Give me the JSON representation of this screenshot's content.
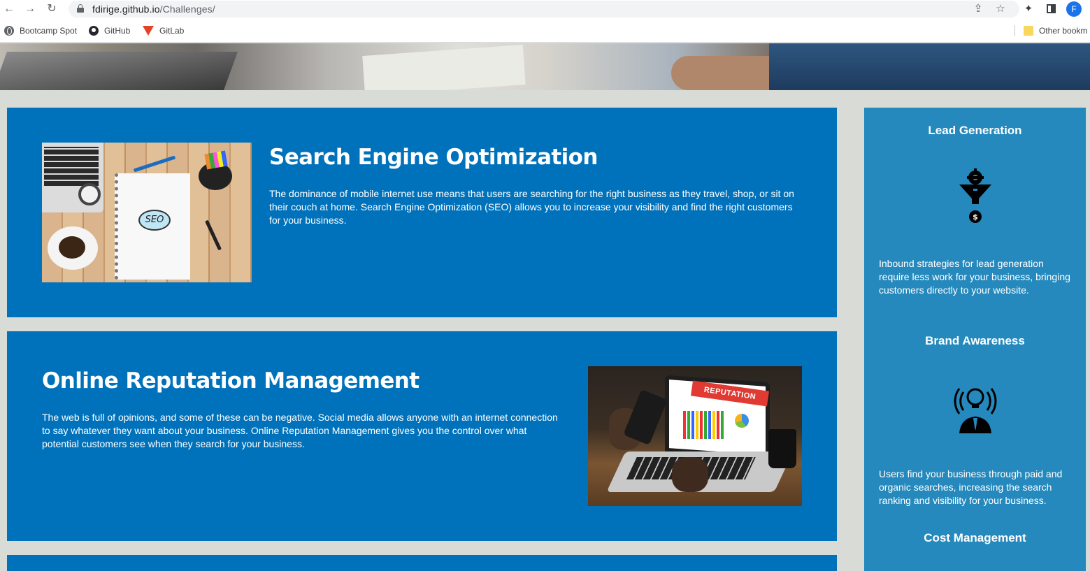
{
  "browser": {
    "url_host": "fdirige.github.io",
    "url_path": "/Challenges/",
    "profile_initial": "F",
    "bookmarks": [
      "Bootcamp Spot",
      "GitHub",
      "GitLab"
    ],
    "other_bookmarks": "Other bookm"
  },
  "cards": [
    {
      "title": "Search Engine Optimization",
      "text": "The dominance of mobile internet use means that users are searching for the right business as they travel, shop, or sit on their couch at home. Search Engine Optimization (SEO) allows you to increase your visibility and find the right customers for your business.",
      "image_text": "SEO"
    },
    {
      "title": "Online Reputation Management",
      "text": "The web is full of opinions, and some of these can be negative. Social media allows anyone with an internet connection to say whatever they want about your business. Online Reputation Management gives you the control over what potential customers see when they search for your business.",
      "image_text": "REPUTATION"
    }
  ],
  "sidebar": {
    "benefits": [
      {
        "title": "Lead Generation",
        "icon": "lead-funnel-icon",
        "text": "Inbound strategies for lead generation require less work for your business, bringing customers directly to your website."
      },
      {
        "title": "Brand Awareness",
        "icon": "brand-broadcast-icon",
        "text": "Users find your business through paid and organic searches, increasing the search ranking and visibility for your business."
      },
      {
        "title": "Cost Management",
        "icon": "cost-icon"
      }
    ]
  },
  "colors": {
    "page_bg": "#d9dcd6",
    "card_bg": "#0072bb",
    "sidebar_bg": "#2589bd"
  }
}
